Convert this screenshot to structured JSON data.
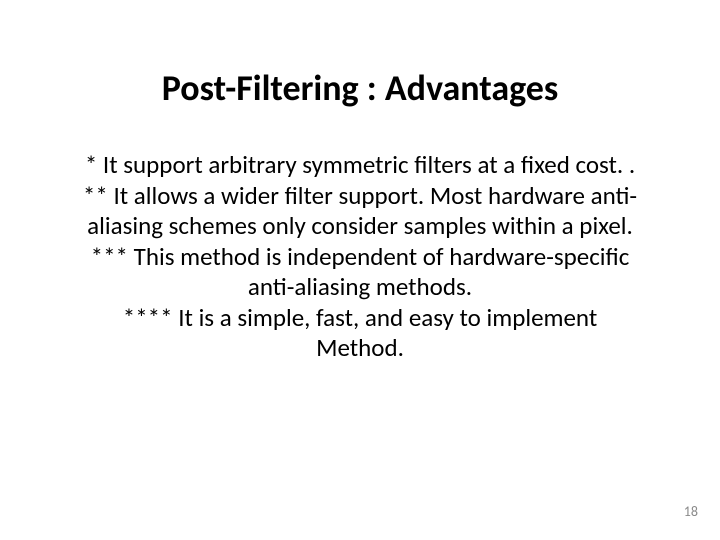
{
  "slide": {
    "title": "Post-Filtering : Advantages",
    "body_lines": [
      "* It support arbitrary symmetric filters at a fixed cost. .",
      "** It allows a wider filter support. Most hardware anti-",
      "aliasing schemes only consider samples within a pixel.",
      "*** This method is independent of hardware-specific",
      "anti-aliasing methods.",
      "**** It is a simple, fast, and easy to implement",
      "Method."
    ],
    "page_number": "18"
  }
}
